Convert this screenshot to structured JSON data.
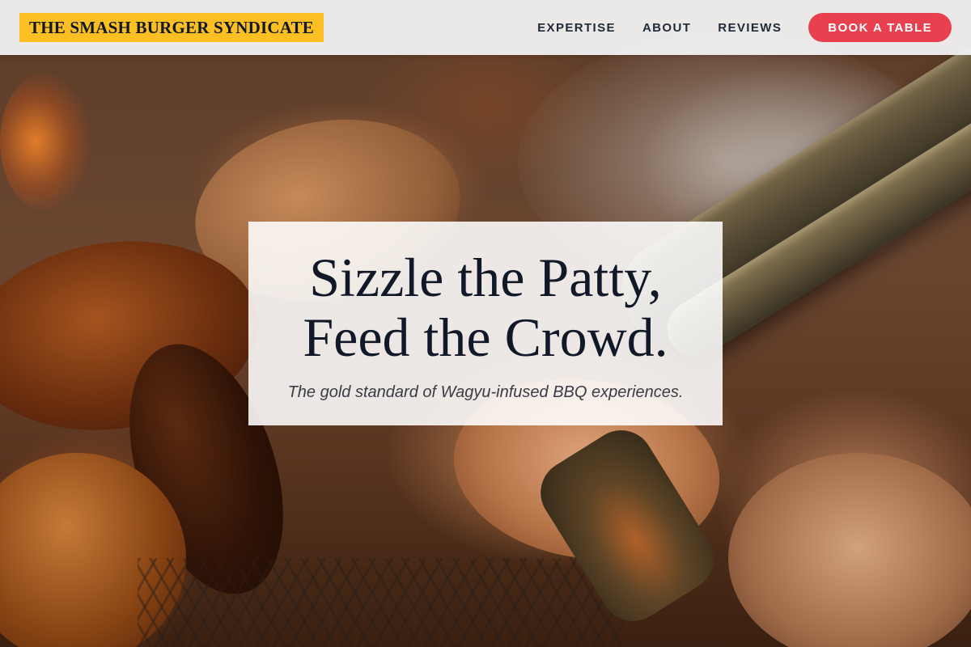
{
  "header": {
    "brand": "THE SMASH BURGER SYNDICATE",
    "nav": [
      {
        "label": "EXPERTISE"
      },
      {
        "label": "ABOUT"
      },
      {
        "label": "REVIEWS"
      }
    ],
    "cta_label": "BOOK A TABLE"
  },
  "hero": {
    "title_line1": "Sizzle the Patty,",
    "title_line2": "Feed the Crowd.",
    "subtitle": "The gold standard of Wagyu-infused BBQ experiences.",
    "background": "grilled-meat-photo"
  },
  "colors": {
    "brand_badge": "#fbbf24",
    "cta": "#e8404f",
    "header_bg": "#f0f0f0",
    "text_dark": "#111827"
  }
}
